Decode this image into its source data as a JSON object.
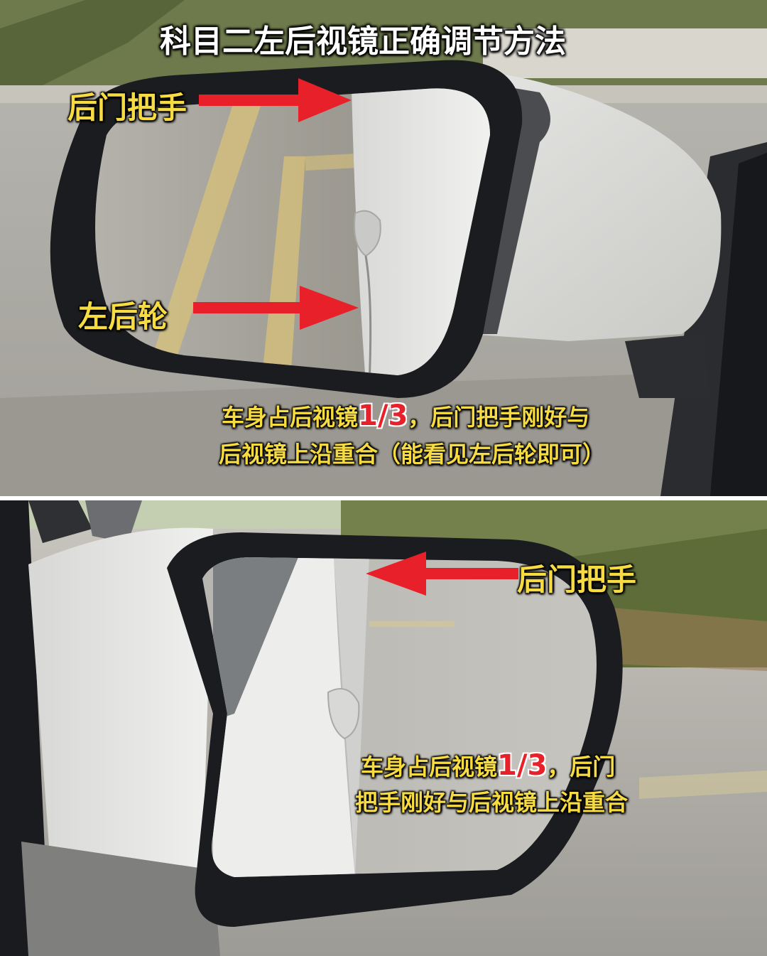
{
  "title": "科目二左后视镜正确调节方法",
  "top_panel": {
    "label_door_handle": "后门把手",
    "label_rear_wheel": "左后轮",
    "caption_prefix": "车身占后视镜",
    "caption_ratio": "1/3",
    "caption_suffix": "，后门把手刚好与",
    "caption_line2": "后视镜上沿重合（能看见左后轮即可）"
  },
  "bottom_panel": {
    "label_door_handle": "后门把手",
    "caption_prefix": "车身占后视镜",
    "caption_ratio": "1/3",
    "caption_suffix": "，后门",
    "caption_line2": "把手刚好与后视镜上沿重合"
  },
  "colors": {
    "annotation_yellow": "#f6dc42",
    "arrow_red": "#e8202a",
    "caption_white": "#ffffff"
  }
}
